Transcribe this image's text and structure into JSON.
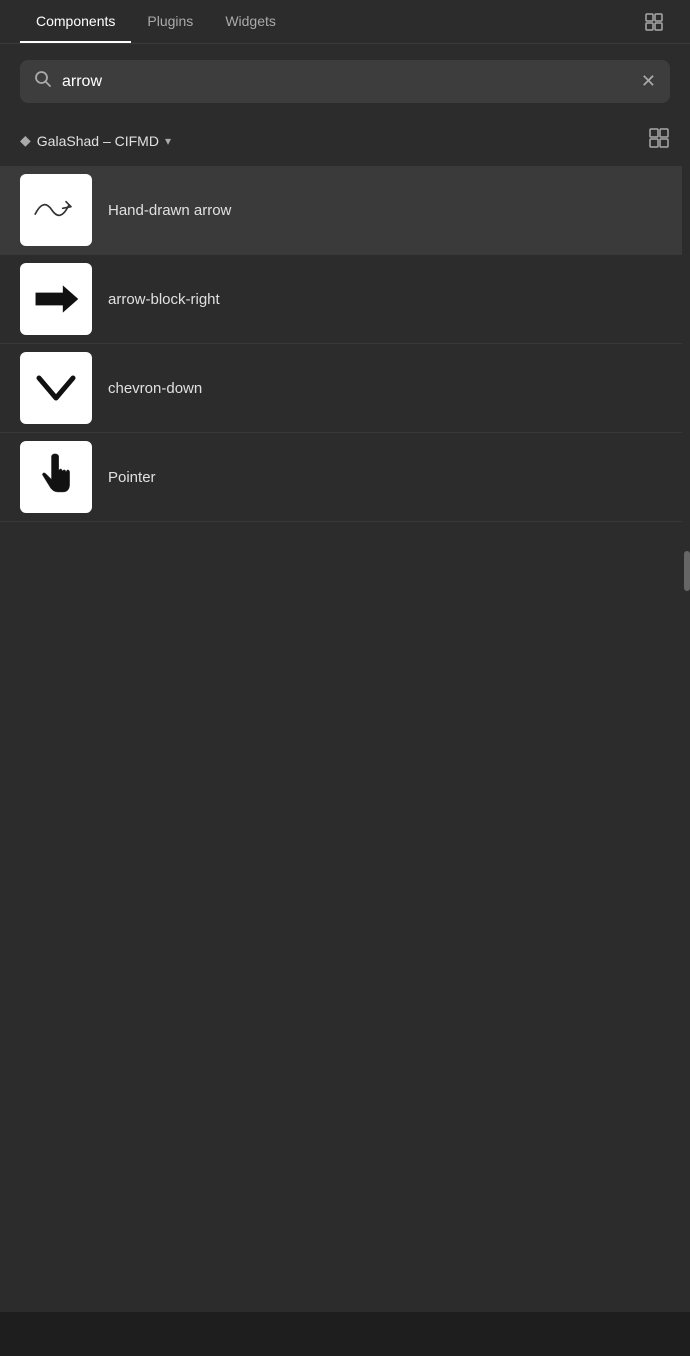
{
  "nav": {
    "tabs": [
      {
        "label": "Components",
        "active": true
      },
      {
        "label": "Plugins",
        "active": false
      },
      {
        "label": "Widgets",
        "active": false
      }
    ],
    "icon": "grid-icon"
  },
  "search": {
    "value": "arrow",
    "placeholder": "Search"
  },
  "library": {
    "name": "GalaShad – CIFMD",
    "has_dropdown": true,
    "grid_icon": "grid-view-icon"
  },
  "components": [
    {
      "id": "hand-drawn-arrow",
      "label": "Hand-drawn arrow",
      "thumbnail_type": "wavy-arrow"
    },
    {
      "id": "arrow-block-right",
      "label": "arrow-block-right",
      "thumbnail_type": "block-arrow"
    },
    {
      "id": "chevron-down",
      "label": "chevron-down",
      "thumbnail_type": "chevron"
    },
    {
      "id": "pointer",
      "label": "Pointer",
      "thumbnail_type": "pointer"
    }
  ]
}
